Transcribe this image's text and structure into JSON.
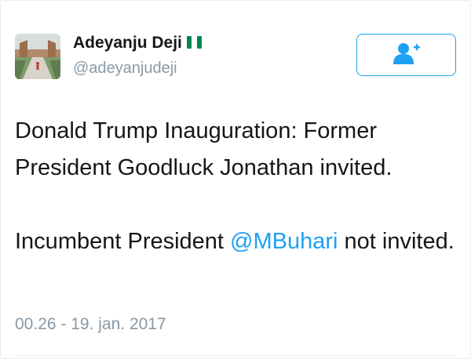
{
  "user": {
    "display_name": "Adeyanju Deji",
    "handle": "@adeyanjudeji",
    "flag_icon": "nigeria-flag-icon"
  },
  "follow_button": {
    "icon": "add-user-icon"
  },
  "tweet": {
    "line1_text": "Donald Trump Inauguration: Former President Goodluck Jonathan invited.",
    "line2_prefix": "Incumbent President ",
    "line2_mention": "@MBuhari",
    "line2_suffix": " not invited.",
    "timestamp": "00.26 - 19. jan. 2017"
  },
  "colors": {
    "accent": "#1da1f2",
    "text": "#14171a",
    "muted": "#8899a6",
    "flag_green": "#008751"
  }
}
